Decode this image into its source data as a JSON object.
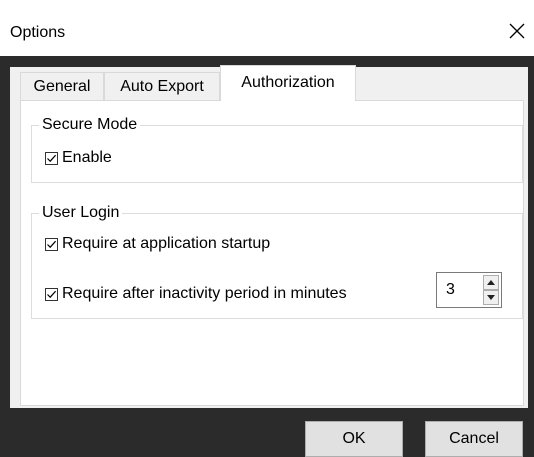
{
  "window": {
    "title": "Options"
  },
  "tabs": [
    {
      "label": "General"
    },
    {
      "label": "Auto Export"
    },
    {
      "label": "Authorization",
      "selected": true
    }
  ],
  "secure_mode": {
    "legend": "Secure Mode",
    "enable": {
      "label": "Enable",
      "checked": true
    }
  },
  "user_login": {
    "legend": "User Login",
    "startup": {
      "label": "Require at application startup",
      "checked": true
    },
    "inactivity": {
      "label": "Require after inactivity period in minutes",
      "checked": true,
      "minutes": "3"
    }
  },
  "buttons": {
    "ok": "OK",
    "cancel": "Cancel"
  },
  "colors": {
    "frame_dark": "#2b2b2b",
    "dialog_bg": "#f0f0f0",
    "page_bg": "#ffffff",
    "button_bg": "#e1e1e1"
  },
  "icons": {
    "close": "close-icon",
    "check": "checkmark-icon",
    "up": "arrow-up-icon",
    "down": "arrow-down-icon"
  }
}
